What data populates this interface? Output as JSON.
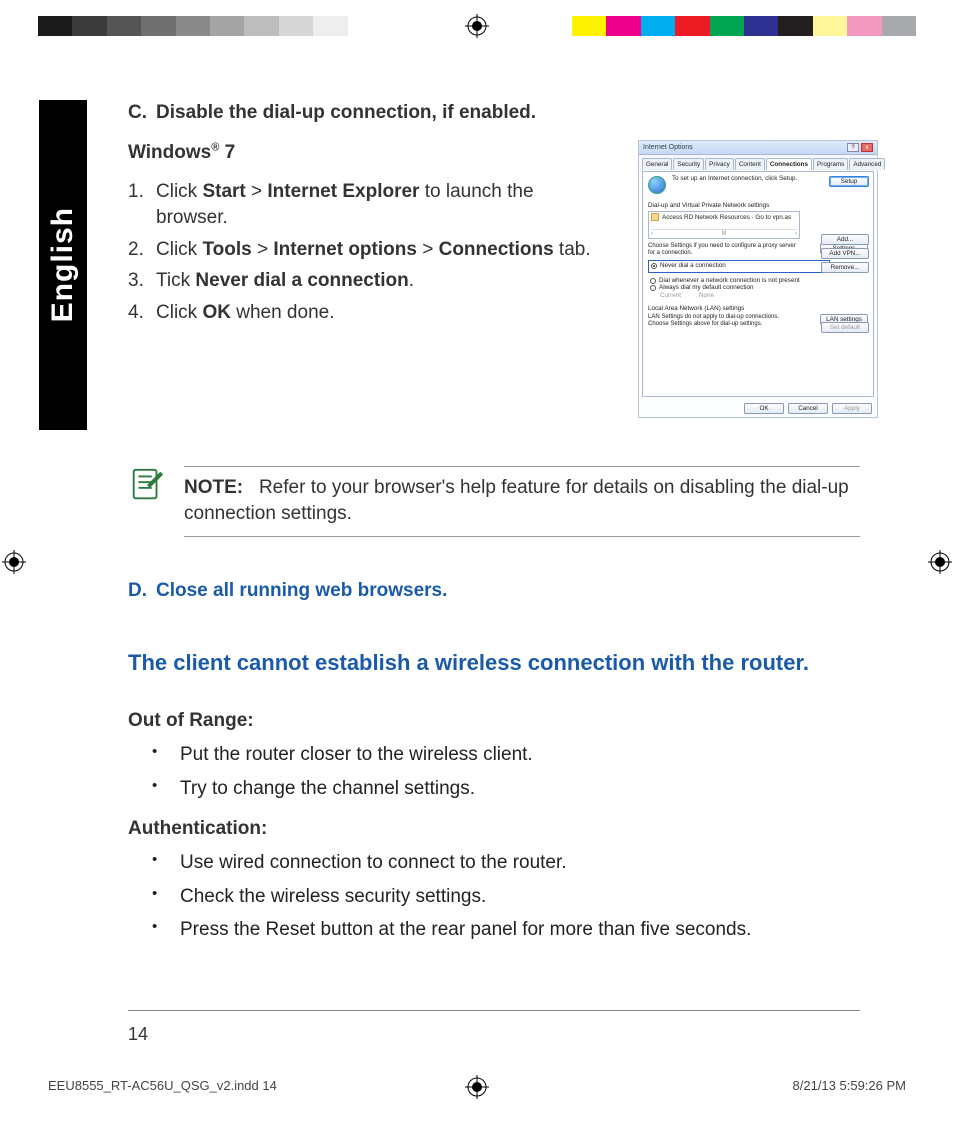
{
  "colorbars": {
    "left": [
      "#1a1a1a",
      "#3a3a3a",
      "#555555",
      "#707070",
      "#8a8a8a",
      "#a4a4a4",
      "#bdbdbd",
      "#d6d6d6",
      "#eeeeee",
      "#ffffff"
    ],
    "right": [
      "#fff200",
      "#ec008c",
      "#00aeef",
      "#ed1c24",
      "#00a651",
      "#2e3192",
      "#231f20",
      "#fff799",
      "#f49ac1",
      "#a7a9ac"
    ]
  },
  "language_tab": "English",
  "section_c": {
    "label": "C.",
    "heading": "Disable the dial-up connection, if enabled.",
    "os_heading_prefix": "Windows",
    "os_heading_suffix": " 7",
    "steps": [
      {
        "n": "1",
        "pre": "Click ",
        "b1": "Start",
        "mid": " > ",
        "b2": "Internet Explorer",
        "post": " to launch the browser."
      },
      {
        "n": "2",
        "pre": "Click ",
        "b1": "Tools",
        "mid": " > ",
        "b2": "Internet options",
        "mid2": " > ",
        "b3": "Connections",
        "post": " tab."
      },
      {
        "n": "3",
        "pre": "Tick ",
        "b1": "Never dial a connection",
        "post": "."
      },
      {
        "n": "4",
        "pre": "Click ",
        "b1": "OK",
        "post": " when done."
      }
    ]
  },
  "dlg": {
    "title": "Internet Options",
    "tabs": [
      "General",
      "Security",
      "Privacy",
      "Content",
      "Connections",
      "Programs",
      "Advanced"
    ],
    "active_tab_index": 4,
    "setup_text": "To set up an Internet connection, click Setup.",
    "setup_btn": "Setup",
    "vpn_group": "Dial-up and Virtual Private Network settings",
    "vpn_entry": "Access RD Network Resources - Go to vpn.as",
    "add_btn": "Add...",
    "addvpn_btn": "Add VPN...",
    "remove_btn": "Remove...",
    "settings_hint": "Choose Settings if you need to configure a proxy server for a connection.",
    "settings_btn": "Settings",
    "radio_never": "Never dial a connection",
    "radio_whenever": "Dial whenever a network connection is not present",
    "radio_always": "Always dial my default connection",
    "current_lbl": "Current",
    "current_val": "None",
    "setdefault_btn": "Set default",
    "lan_group": "Local Area Network (LAN) settings",
    "lan_hint": "LAN Settings do not apply to dial-up connections. Choose Settings above for dial-up settings.",
    "lan_btn": "LAN settings",
    "ok": "OK",
    "cancel": "Cancel",
    "apply": "Apply"
  },
  "note": {
    "label": "NOTE:",
    "text": "Refer to your browser's help feature for details on disabling the dial-up connection settings."
  },
  "section_d": {
    "label": "D.",
    "heading": "Close all running web browsers."
  },
  "issue_heading": "The client cannot establish a wireless connection with the router.",
  "out_of_range": {
    "heading": "Out of Range:",
    "items": [
      "Put the router closer to the wireless client.",
      "Try to change the channel settings."
    ]
  },
  "authentication": {
    "heading": "Authentication:",
    "items": [
      "Use wired connection to connect to the router.",
      "Check the wireless security settings.",
      "Press the Reset button at the rear panel for more than five seconds."
    ]
  },
  "page_number": "14",
  "doc_footer": {
    "file": "EEU8555_RT-AC56U_QSG_v2.indd   14",
    "stamp": "8/21/13   5:59:26 PM"
  }
}
